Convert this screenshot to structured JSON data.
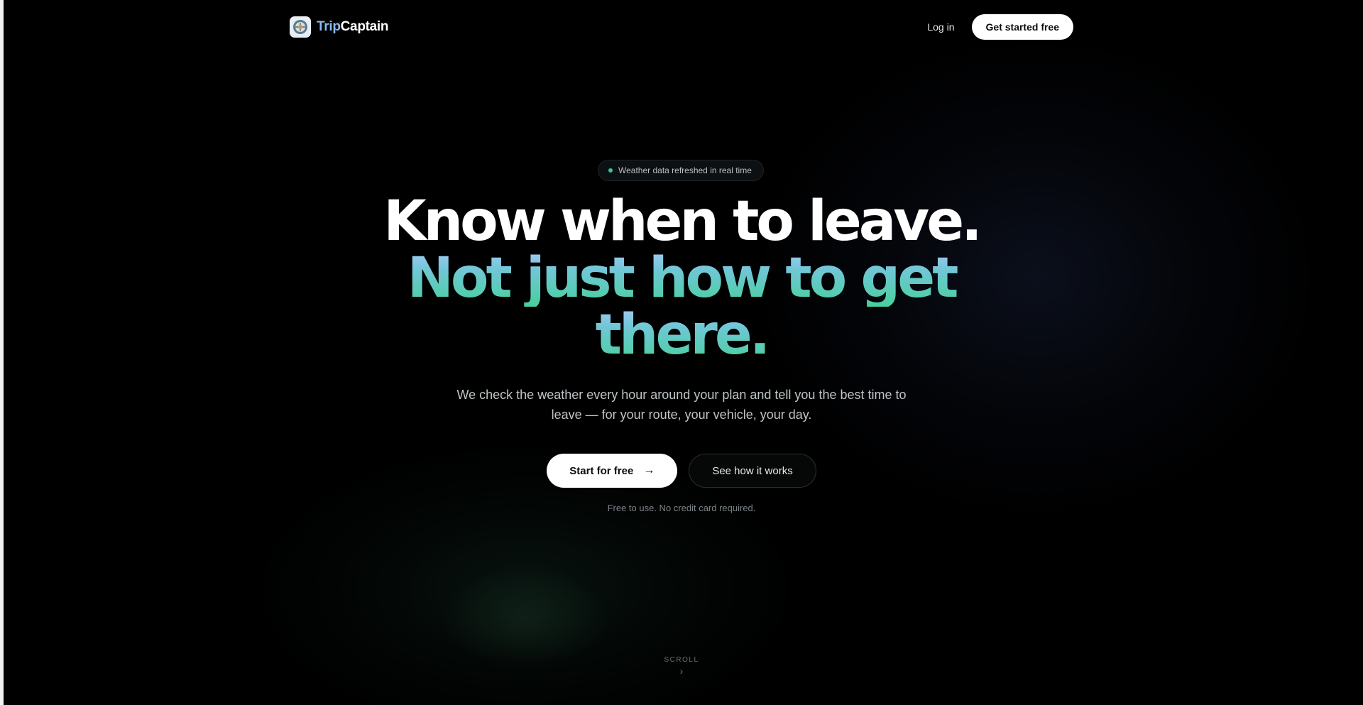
{
  "header": {
    "brand_trip": "Trip",
    "brand_captain": "Captain",
    "login_label": "Log in",
    "cta_label": "Get started free"
  },
  "hero": {
    "badge_text": "Weather data refreshed in real time",
    "headline_line1": "Know when to leave.",
    "headline_line2": "Not just how to get",
    "headline_line3": "there.",
    "subtitle": "We check the weather every hour around your plan and tell you the best time to leave — for your route, your vehicle, your day.",
    "primary_cta": "Start for free",
    "secondary_cta": "See how it works",
    "note": "Free to use. No credit card required."
  },
  "scroll": {
    "label": "SCROLL"
  },
  "icons": {
    "logo": "logo-icon",
    "arrow": "arrow-right-icon",
    "chevron": "chevron-down-icon",
    "status_dot": "status-dot-icon"
  },
  "colors": {
    "background": "#000000",
    "brand_accent": "#8ab8f0",
    "gradient_top": "#a7c8f6",
    "gradient_bottom": "#48cf9c",
    "status_green": "#39c98f"
  }
}
